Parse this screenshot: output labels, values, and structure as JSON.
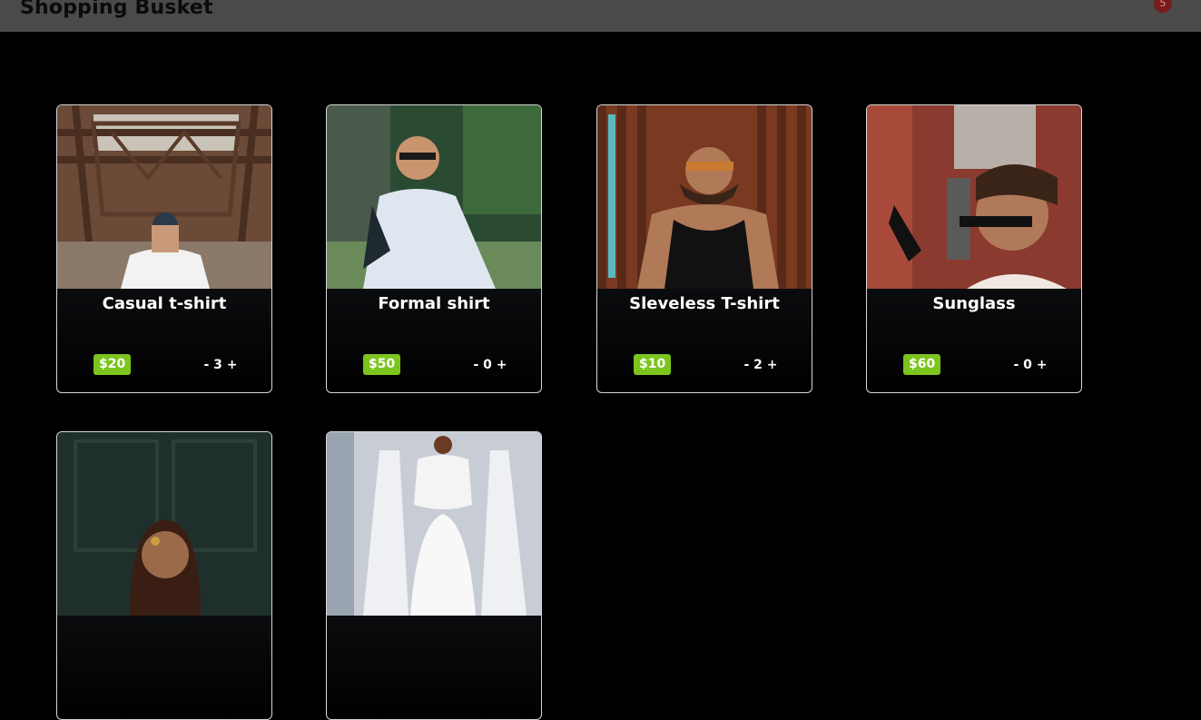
{
  "header": {
    "title": "Shopping Busket",
    "cart_count": "5",
    "colors": {
      "bar": "#4a4a4a",
      "badge": "#7a1a1a"
    }
  },
  "products": [
    {
      "name": "Casual t-shirt",
      "price": "$20",
      "qty": "3",
      "minus": "-",
      "plus": "+"
    },
    {
      "name": "Formal shirt",
      "price": "$50",
      "qty": "0",
      "minus": "-",
      "plus": "+"
    },
    {
      "name": "Sleveless T-shirt",
      "price": "$10",
      "qty": "2",
      "minus": "-",
      "plus": "+"
    },
    {
      "name": "Sunglass",
      "price": "$60",
      "qty": "0",
      "minus": "-",
      "plus": "+"
    },
    {
      "name": "",
      "price": "",
      "qty": "",
      "minus": "",
      "plus": ""
    },
    {
      "name": "",
      "price": "",
      "qty": "",
      "minus": "",
      "plus": ""
    }
  ],
  "colors": {
    "price_badge": "#7cc41e",
    "card_border": "#d6d6d6"
  }
}
